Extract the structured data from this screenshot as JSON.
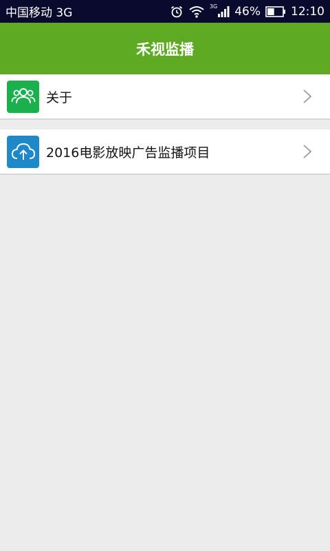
{
  "status_bar": {
    "carrier": "中国移动 3G",
    "network_small": "3G",
    "battery_percent": "46%",
    "battery_level": 0.46,
    "time": "12:10"
  },
  "header": {
    "title": "禾视监播"
  },
  "list": {
    "items": [
      {
        "label": "关于",
        "icon": "users-icon",
        "icon_color": "#1ab04b"
      },
      {
        "label": "2016电影放映广告监播项目",
        "icon": "cloud-upload-icon",
        "icon_color": "#1f88c9"
      }
    ]
  },
  "colors": {
    "header_bg": "#5eaa22",
    "status_bg": "#0a0a2e",
    "page_bg": "#ececec"
  }
}
